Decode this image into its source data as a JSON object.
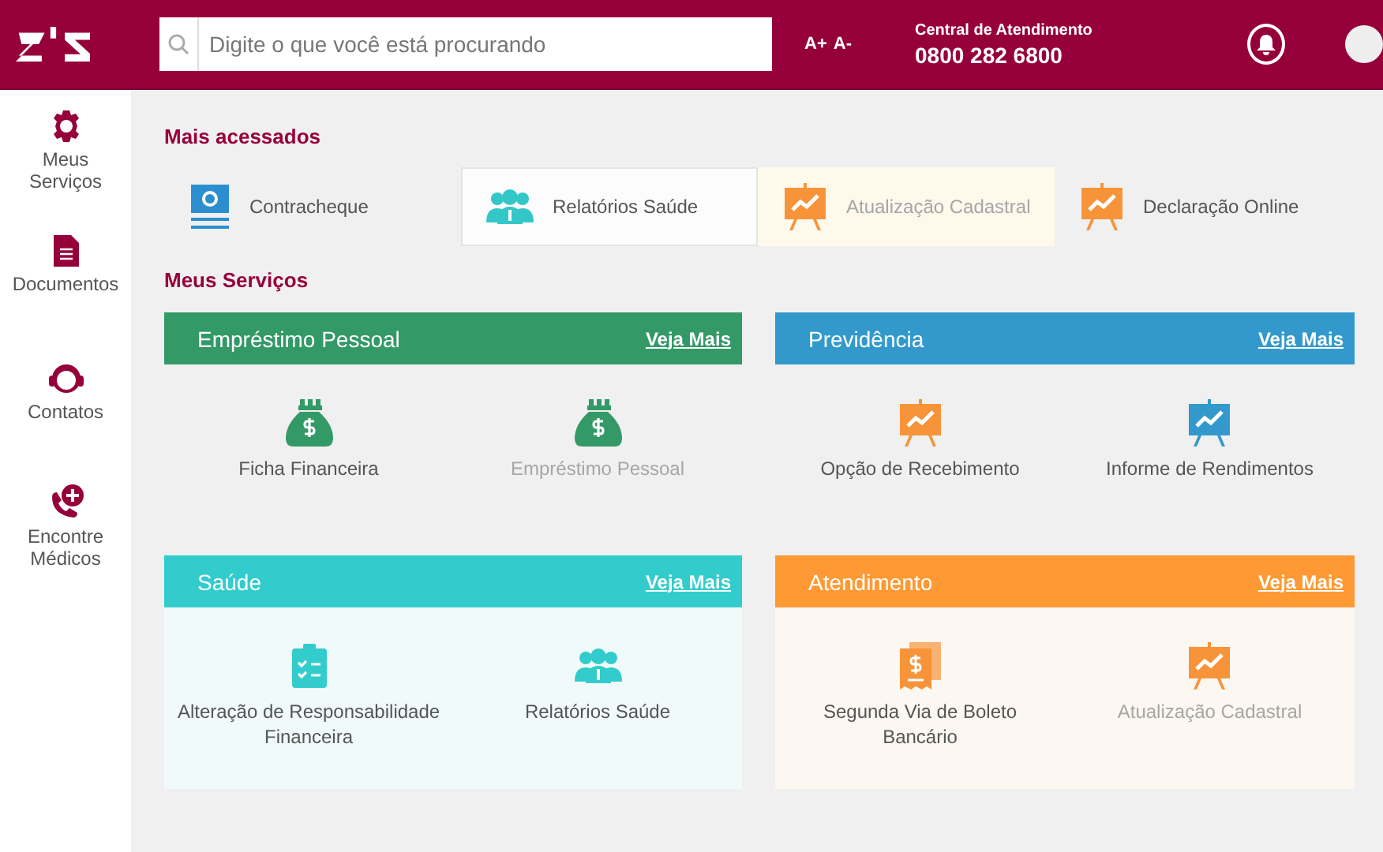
{
  "header": {
    "search": {
      "placeholder": "Digite o que você está procurando"
    },
    "font_buttons": [
      "A+",
      "A-"
    ],
    "support": {
      "label": "Central de Atendimento",
      "phone": "0800 282 6800"
    }
  },
  "sidebar": {
    "items": [
      {
        "label": "Meus Serviços",
        "kind": "gear"
      },
      {
        "label": "Documentos",
        "kind": "document"
      },
      {
        "label": "Contatos",
        "kind": "headset"
      },
      {
        "label": "Encontre Médicos",
        "kind": "phone"
      }
    ]
  },
  "most_accessed": {
    "title": "Mais acessados",
    "items": [
      {
        "label": "Contracheque",
        "kind": "banknote",
        "color": "#2b8fcf",
        "highlighted": false,
        "disabled": false
      },
      {
        "label": "Relatórios Saúde",
        "kind": "people",
        "color": "#33c7c7",
        "highlighted": true,
        "disabled": false
      },
      {
        "label": "Atualização Cadastral",
        "kind": "chart",
        "color": "#f7943a",
        "highlighted": false,
        "disabled": true
      },
      {
        "label": "Declaração Online",
        "kind": "chart",
        "color": "#f7943a",
        "highlighted": false,
        "disabled": false
      }
    ]
  },
  "services": {
    "title": "Meus Serviços",
    "cards": [
      {
        "title": "Empréstimo Pessoal",
        "link": "Veja Mais",
        "color": "#339966",
        "highlighted": false,
        "items": [
          {
            "label": "Ficha Financeira",
            "kind": "money-bag",
            "color": "#339966",
            "disabled": false
          },
          {
            "label": "Empréstimo Pessoal",
            "kind": "money-bag",
            "color": "#339966",
            "disabled": true
          }
        ]
      },
      {
        "title": "Previdência",
        "link": "Veja Mais",
        "color": "#3399cc",
        "highlighted": false,
        "items": [
          {
            "label": "Opção de Recebimento",
            "kind": "chart",
            "color": "#f7943a",
            "disabled": false
          },
          {
            "label": "Informe de Rendimentos",
            "kind": "chart",
            "color": "#3399cc",
            "disabled": false
          }
        ]
      },
      {
        "title": "Saúde",
        "link": "Veja Mais",
        "color": "#33cccc",
        "highlighted": true,
        "items": [
          {
            "label": "Alteração de Responsabilidade Financeira",
            "kind": "clipboard",
            "color": "#33cccc",
            "disabled": false
          },
          {
            "label": "Relatórios Saúde",
            "kind": "people",
            "color": "#33cccc",
            "disabled": false
          }
        ]
      },
      {
        "title": "Atendimento",
        "link": "Veja Mais",
        "color": "#ff9933",
        "highlighted": true,
        "items": [
          {
            "label": "Segunda Via de Boleto Bancário",
            "kind": "receipt",
            "color": "#f7943a",
            "disabled": false
          },
          {
            "label": "Atualização Cadastral",
            "kind": "chart",
            "color": "#f7943a",
            "disabled": true
          }
        ]
      }
    ]
  }
}
